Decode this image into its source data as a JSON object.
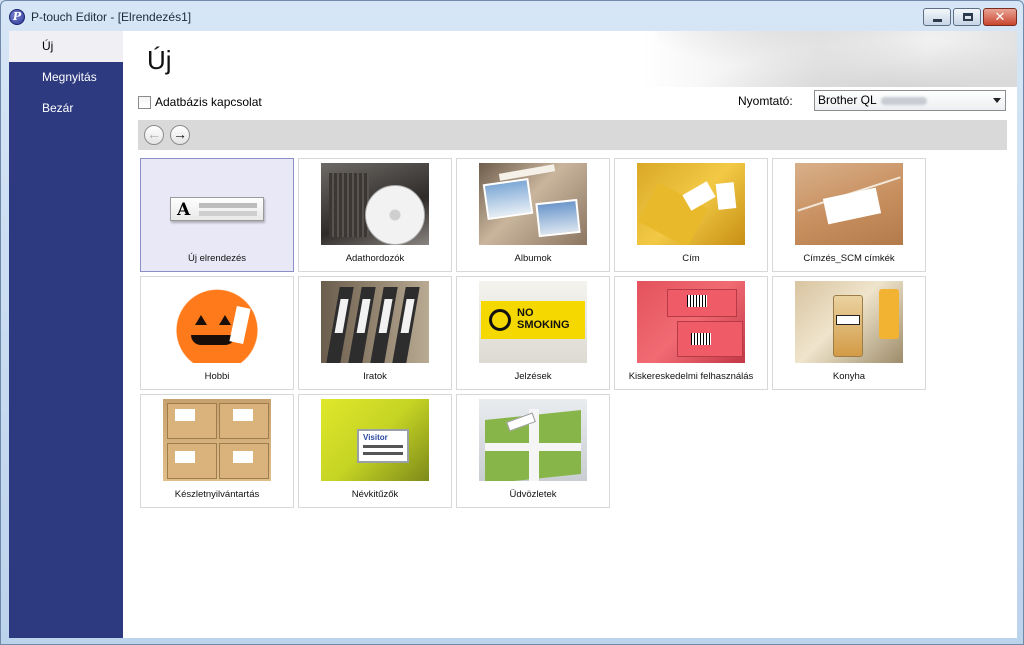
{
  "window": {
    "title": "P-touch Editor - [Elrendezés1]",
    "app_icon_glyph": "P",
    "close_glyph": "✕"
  },
  "sidebar": {
    "items": [
      {
        "label": "Új",
        "active": true
      },
      {
        "label": "Megnyitás",
        "active": false
      },
      {
        "label": "Bezár",
        "active": false
      }
    ]
  },
  "main": {
    "title": "Új",
    "database_checkbox_label": "Adatbázis kapcsolat",
    "database_checked": false,
    "printer_label": "Nyomtató:",
    "printer_value": "Brother QL",
    "nav": {
      "back_glyph": "←",
      "forward_glyph": "→"
    }
  },
  "sign_thumbnail_text": "NO SMOKING",
  "badge_thumbnail_text": "Visitor",
  "templates": [
    {
      "label": "Új elrendezés",
      "thumb": "new",
      "selected": true
    },
    {
      "label": "Adathordozók",
      "thumb": "media",
      "selected": false
    },
    {
      "label": "Albumok",
      "thumb": "album",
      "selected": false
    },
    {
      "label": "Cím",
      "thumb": "addr",
      "selected": false
    },
    {
      "label": "Címzés_SCM címkék",
      "thumb": "scm",
      "selected": false
    },
    {
      "label": "Hobbi",
      "thumb": "hobby",
      "selected": false
    },
    {
      "label": "Iratok",
      "thumb": "files",
      "selected": false
    },
    {
      "label": "Jelzések",
      "thumb": "signs",
      "selected": false
    },
    {
      "label": "Kiskereskedelmi felhasználás",
      "thumb": "retail",
      "selected": false
    },
    {
      "label": "Konyha",
      "thumb": "kitchen",
      "selected": false
    },
    {
      "label": "Készletnyilvántartás",
      "thumb": "inventory",
      "selected": false
    },
    {
      "label": "Névkitűzők",
      "thumb": "badge",
      "selected": false
    },
    {
      "label": "Üdvözletek",
      "thumb": "gift",
      "selected": false
    }
  ],
  "colors": {
    "sidebar_bg": "#2e3a80",
    "selected_tile_bg": "#e8e8f6",
    "nav_bar_bg": "#d9d9d9"
  }
}
